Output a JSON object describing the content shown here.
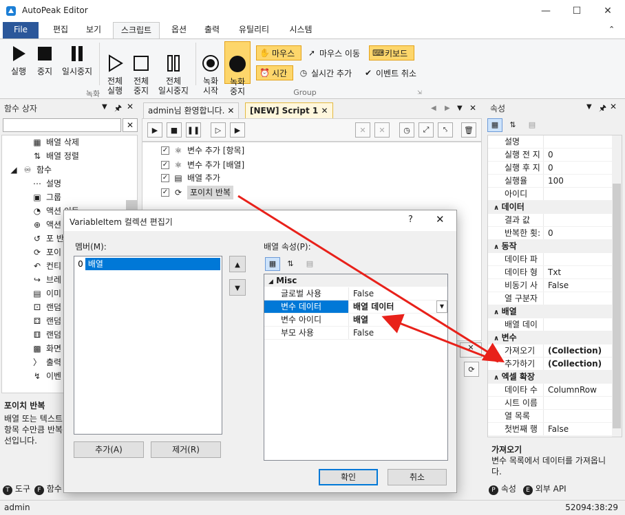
{
  "app": {
    "title": "AutoPeak Editor"
  },
  "ribbon": {
    "tabs": [
      "File",
      "편집",
      "보기",
      "스크립트",
      "옵션",
      "출력",
      "유틸리티",
      "시스템"
    ],
    "buttons": {
      "run": "실행",
      "stop": "중지",
      "pause": "일시중지",
      "run_all": "전체\n실행",
      "stop_all": "전체\n중지",
      "pause_all": "전체\n일시중지",
      "rec_start": "녹화\n시작",
      "rec_stop": "녹화\n중지"
    },
    "small": {
      "mouse": "마우스",
      "mouse_move": "마우스 이동",
      "keyboard": "키보드",
      "time": "시간",
      "realtime_add": "실시간 추가",
      "event_cancel": "이벤트 취소"
    },
    "groups": {
      "record": "녹화",
      "group": "Group"
    }
  },
  "left_panel": {
    "title": "함수 상자",
    "items": [
      "배열 삭제",
      "배열 정렬",
      "함수",
      "설명",
      "그룹",
      "액션 이동",
      "액션",
      "포 반",
      "포이",
      "컨티",
      "브레",
      "이미",
      "랜덤",
      "랜덤",
      "랜덤",
      "화면",
      "출력",
      "이벤"
    ],
    "desc_title": "포이치 반복",
    "desc_text": "배열 또는 텍스트\n항목 수만큼 반복\n선입니다.",
    "bottom_tabs": [
      "도구",
      "함수"
    ]
  },
  "doc_tabs": {
    "tab1": "admin님 환영합니다.",
    "tab2": "[NEW] Script 1"
  },
  "script_rows": [
    "변수 추가 [항목]",
    "변수 추가 [배열]",
    "배열 추가",
    "포이치 반복"
  ],
  "right_panel": {
    "title": "속성",
    "categories": {
      "c0": [
        {
          "k": "설명",
          "v": ""
        },
        {
          "k": "실행 전 지",
          "v": "0"
        },
        {
          "k": "실행 후 지",
          "v": "0"
        },
        {
          "k": "실행율",
          "v": "100"
        },
        {
          "k": "아이디",
          "v": ""
        }
      ],
      "data_label": "데이터",
      "data": [
        {
          "k": "결과 값",
          "v": ""
        },
        {
          "k": "반복한 횟:",
          "v": "0"
        }
      ],
      "action_label": "동작",
      "action": [
        {
          "k": "데이타 파",
          "v": ""
        },
        {
          "k": "데이타 형",
          "v": "Txt"
        },
        {
          "k": "비동기 사",
          "v": "False"
        },
        {
          "k": "열 구분자",
          "v": ""
        }
      ],
      "array_label": "배열",
      "array": [
        {
          "k": "배열 데이",
          "v": ""
        }
      ],
      "var_label": "변수",
      "var": [
        {
          "k": "가져오기",
          "v": "(Collection)"
        },
        {
          "k": "추가하기",
          "v": "(Collection)"
        }
      ],
      "excel_label": "엑셀 확장",
      "excel": [
        {
          "k": "데이타 수",
          "v": "ColumnRow"
        },
        {
          "k": "시트 이름",
          "v": ""
        },
        {
          "k": "열 목록",
          "v": ""
        },
        {
          "k": "첫번째 행",
          "v": "False"
        }
      ]
    },
    "desc_title": "가져오기",
    "desc_text": "변수 목록에서 데이터를 가져옵니\n다.",
    "bottom_tabs": [
      "속성",
      "외부 API"
    ]
  },
  "dialog": {
    "title": "VariableItem 컬렉션 편집기",
    "help": "?",
    "members_label": "멤버(M):",
    "member_index": "0",
    "member_name": "배열",
    "props_label": "배열 속성(P):",
    "category": "Misc",
    "props": [
      {
        "k": "글로벌 사용",
        "v": "False"
      },
      {
        "k": "변수 데이터",
        "v": "배열 데이터"
      },
      {
        "k": "변수 아이디",
        "v": "배열"
      },
      {
        "k": "부모 사용",
        "v": "False"
      }
    ],
    "add": "추가(A)",
    "remove": "제거(R)",
    "ok": "확인",
    "cancel": "취소"
  },
  "status": {
    "user": "admin",
    "time": "52094:38:29"
  }
}
